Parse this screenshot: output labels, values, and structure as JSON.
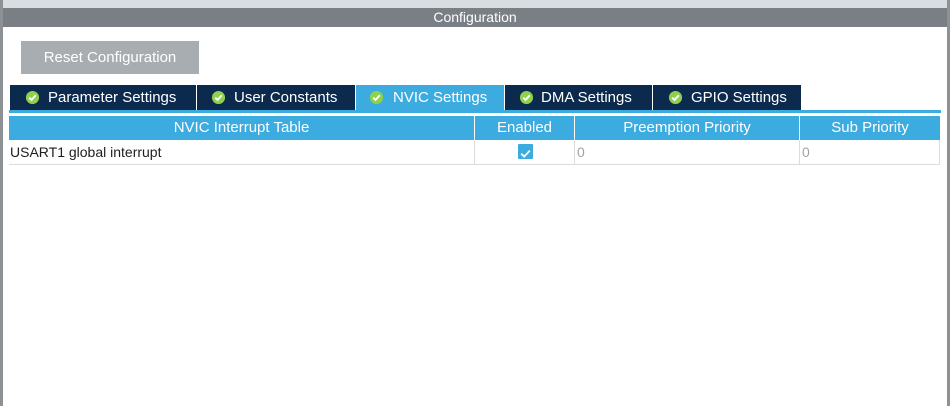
{
  "window": {
    "title": "Configuration"
  },
  "toolbar": {
    "reset_label": "Reset Configuration"
  },
  "tabs": [
    {
      "label": "Parameter Settings",
      "icon": "check-circle-icon",
      "active": false
    },
    {
      "label": "User Constants",
      "icon": "check-circle-icon",
      "active": false
    },
    {
      "label": "NVIC Settings",
      "icon": "check-circle-icon",
      "active": true
    },
    {
      "label": "DMA Settings",
      "icon": "check-circle-icon",
      "active": false
    },
    {
      "label": "GPIO Settings",
      "icon": "check-circle-icon",
      "active": false
    }
  ],
  "table": {
    "headers": [
      "NVIC Interrupt Table",
      "Enabled",
      "Preemption Priority",
      "Sub Priority"
    ],
    "rows": [
      {
        "name": "USART1 global interrupt",
        "enabled": true,
        "preemption": "0",
        "sub": "0"
      }
    ]
  },
  "colors": {
    "accent": "#3cabe0",
    "tab_dark": "#0b2a4d",
    "title_bar": "#797f85",
    "button": "#a8adb1"
  }
}
